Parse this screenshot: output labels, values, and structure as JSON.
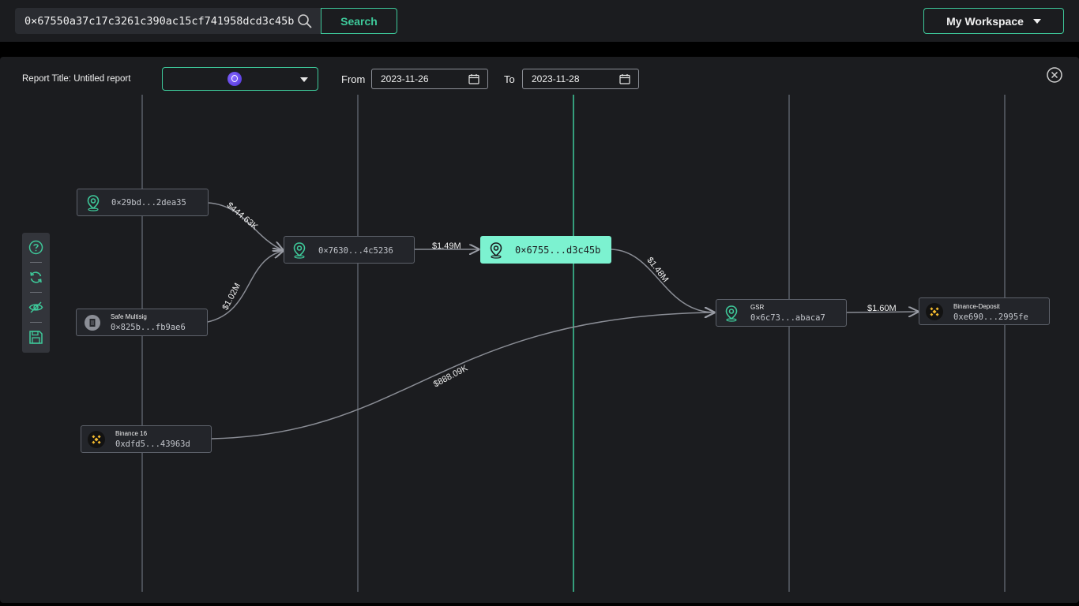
{
  "header": {
    "search_value": "0×67550a37c17c3261c390ac15cf741958dcd3c45b",
    "search_label": "Search",
    "workspace_label": "My Workspace"
  },
  "report": {
    "title_label": "Report Title: Untitled report",
    "from_label": "From",
    "from_date": "2023-11-26",
    "to_label": "To",
    "to_date": "2023-11-28"
  },
  "toolbar": {
    "items": [
      "help-icon",
      "refresh-icon",
      "hide-icon",
      "save-icon"
    ]
  },
  "nodes": {
    "n1": {
      "addr": "0×29bd...2dea35"
    },
    "n2": {
      "name": "Safe Multisig",
      "addr": "0×825b...fb9ae6"
    },
    "n3": {
      "name": "Binance 16",
      "addr": "0xdfd5...43963d"
    },
    "n4": {
      "addr": "0×7630...4c5236"
    },
    "n5": {
      "addr": "0×6755...d3c45b"
    },
    "n6": {
      "name": "GSR",
      "addr": "0×6c73...abaca7"
    },
    "n7": {
      "name": "Binance-Deposit",
      "addr": "0xe690...2995fe"
    }
  },
  "edges": {
    "e1": "$444.63K",
    "e2": "$1.02M",
    "e3": "$1.49M",
    "e4": "$1.48M",
    "e5": "$888.09K",
    "e6": "$1.60M"
  },
  "colors": {
    "accent": "#3ec99a",
    "focus_node": "#7cf2d0",
    "binance": "#f3ba2f"
  }
}
